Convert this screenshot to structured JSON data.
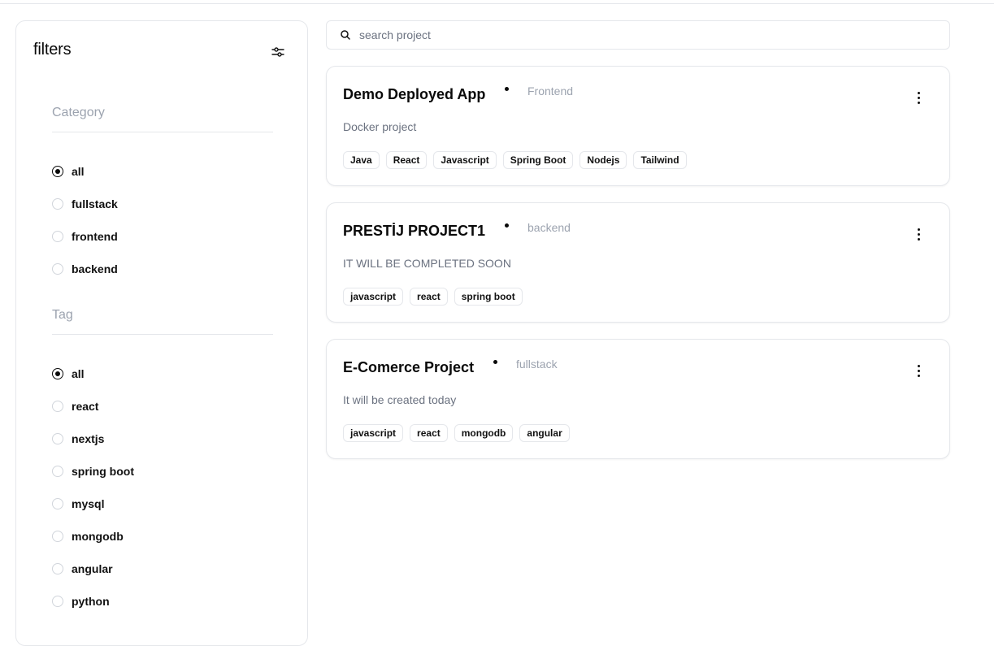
{
  "sidebar": {
    "title": "filters",
    "category_label": "Category",
    "category_options": [
      {
        "label": "all",
        "checked": true
      },
      {
        "label": "fullstack",
        "checked": false
      },
      {
        "label": "frontend",
        "checked": false
      },
      {
        "label": "backend",
        "checked": false
      }
    ],
    "tag_label": "Tag",
    "tag_options": [
      {
        "label": "all",
        "checked": true
      },
      {
        "label": "react",
        "checked": false
      },
      {
        "label": "nextjs",
        "checked": false
      },
      {
        "label": "spring boot",
        "checked": false
      },
      {
        "label": "mysql",
        "checked": false
      },
      {
        "label": "mongodb",
        "checked": false
      },
      {
        "label": "angular",
        "checked": false
      },
      {
        "label": "python",
        "checked": false
      }
    ]
  },
  "search": {
    "placeholder": "search project",
    "value": ""
  },
  "projects": [
    {
      "title": "Demo Deployed App",
      "category": "Frontend",
      "description": "Docker project",
      "tags": [
        "Java",
        "React",
        "Javascript",
        "Spring Boot",
        "Nodejs",
        "Tailwind"
      ]
    },
    {
      "title": "PRESTİJ PROJECT1",
      "category": "backend",
      "description": "IT WILL BE COMPLETED SOON",
      "tags": [
        "javascript",
        "react",
        "spring boot"
      ]
    },
    {
      "title": "E-Comerce Project",
      "category": "fullstack",
      "description": "It will be created today",
      "tags": [
        "javascript",
        "react",
        "mongodb",
        "angular"
      ]
    }
  ]
}
